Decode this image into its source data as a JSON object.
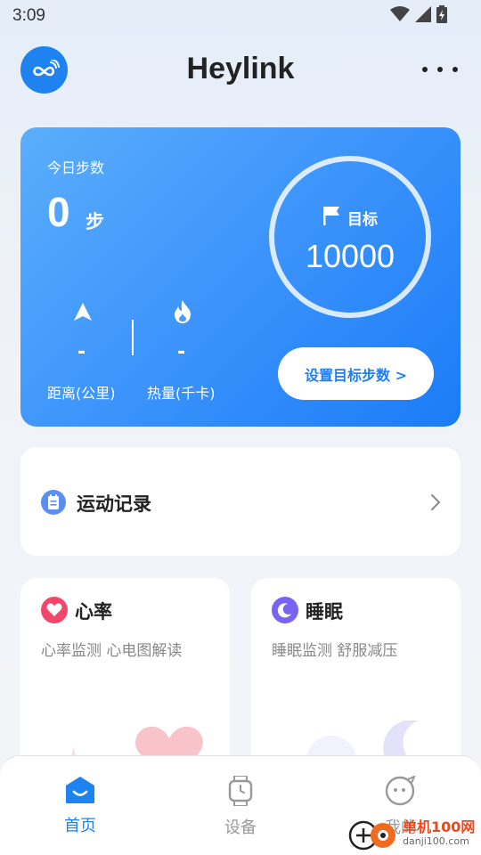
{
  "status_bar": {
    "time": "3:09"
  },
  "header": {
    "title": "Heylink"
  },
  "steps_card": {
    "today_label": "今日步数",
    "steps_value": "0",
    "steps_unit": "步",
    "distance_value": "-",
    "distance_label": "距离(公里)",
    "calories_value": "-",
    "calories_label": "热量(千卡)",
    "goal_label": "目标",
    "goal_value": "10000",
    "set_goal_button": "设置目标步数 >"
  },
  "record_card": {
    "title": "运动记录"
  },
  "heart_card": {
    "title": "心率",
    "subtitle": "心率监测 心电图解读"
  },
  "sleep_card": {
    "title": "睡眠",
    "subtitle": "睡眠监测 舒服减压"
  },
  "bottom_nav": {
    "items": [
      {
        "label": "首页",
        "icon": "home-icon",
        "active": true
      },
      {
        "label": "设备",
        "icon": "watch-icon",
        "active": false
      },
      {
        "label": "我的",
        "icon": "profile-icon",
        "active": false
      }
    ]
  },
  "watermark": {
    "name": "单机100网",
    "url": "danji100.com"
  },
  "colors": {
    "accent": "#1e83f0",
    "card_gradient_start": "#5aaefb",
    "card_gradient_end": "#1b7cf8",
    "heart": "#f4456b",
    "sleep": "#7a63f0",
    "nav_active": "#1e83f0",
    "nav_inactive": "#999999"
  }
}
